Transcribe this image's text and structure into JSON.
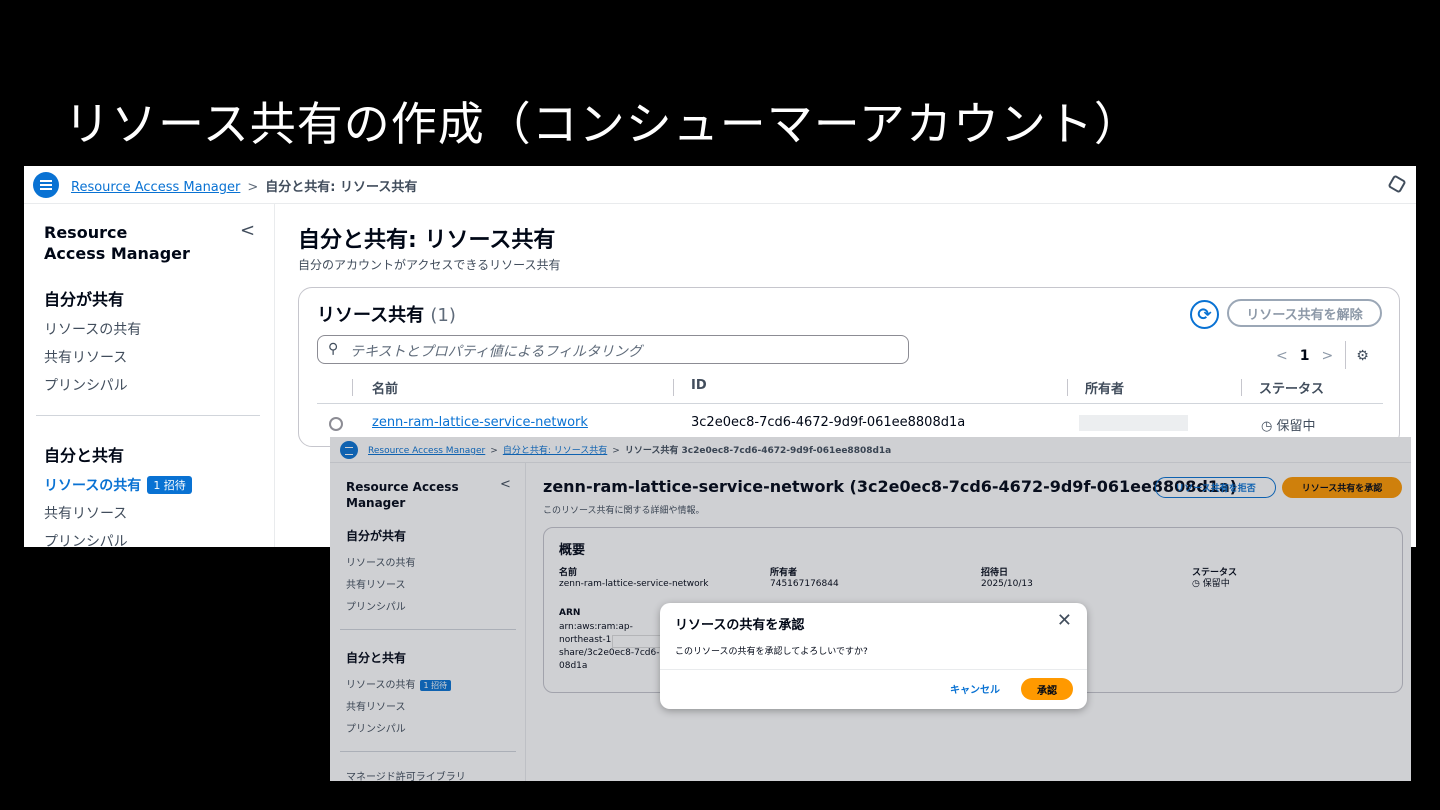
{
  "slide_title": "リソース共有の作成（コンシューマーアカウント）",
  "ss1": {
    "breadcrumb": {
      "root": "Resource Access Manager",
      "sep": ">",
      "current": "自分と共有: リソース共有"
    },
    "sidebar": {
      "title": "Resource Access Manager",
      "collapse": "<",
      "section1": "自分が共有",
      "section1_items": [
        "リソースの共有",
        "共有リソース",
        "プリンシパル"
      ],
      "section2": "自分と共有",
      "section2_items": [
        "リソースの共有",
        "共有リソース",
        "プリンシパル"
      ],
      "badge": "1 招待"
    },
    "page_title": "自分と共有: リソース共有",
    "page_subtitle": "自分のアカウントがアクセスできるリソース共有",
    "card_title": "リソース共有",
    "card_count": "(1)",
    "refresh_icon": "⟳",
    "disassociate_button": "リソース共有を解除",
    "filter_placeholder": "テキストとプロパティ値によるフィルタリング",
    "pager": {
      "prev": "<",
      "page": "1",
      "next": ">"
    },
    "columns": [
      "名前",
      "ID",
      "所有者",
      "ステータス"
    ],
    "row": {
      "name": "zenn-ram-lattice-service-network",
      "id": "3c2e0ec8-7cd6-4672-9d9f-061ee8808d1a",
      "status": "保留中"
    }
  },
  "ss2": {
    "breadcrumb": {
      "root": "Resource Access Manager",
      "mid": "自分と共有: リソース共有",
      "current": "リソース共有 3c2e0ec8-7cd6-4672-9d9f-061ee8808d1a"
    },
    "sidebar": {
      "title": "Resource Access Manager",
      "section1": "自分が共有",
      "section1_items": [
        "リソースの共有",
        "共有リソース",
        "プリンシパル"
      ],
      "section2": "自分と共有",
      "section2_items": [
        "リソースの共有",
        "共有リソース",
        "プリンシパル"
      ],
      "badge": "1 招待",
      "extra": "マネージド許可ライブラリ"
    },
    "page_title": "zenn-ram-lattice-service-network (3c2e0ec8-7cd6-4672-9d9f-061ee8808d1a)",
    "page_subtitle": "このリソース共有に関する詳細や情報。",
    "reject_button": "リソース共有を拒否",
    "accept_button": "リソース共有を承認",
    "overview_title": "概要",
    "fields": {
      "name_label": "名前",
      "name_value": "zenn-ram-lattice-service-network",
      "owner_label": "所有者",
      "owner_value": "745167176844",
      "invited_label": "招待日",
      "invited_value": "2025/10/13",
      "status_label": "ステータス",
      "status_value": "保留中",
      "arn_label": "ARN",
      "arn_lines": [
        "arn:aws:ram:ap-",
        "northeast-1",
        "share/3c2e0ec8-7cd6-",
        "08d1a"
      ]
    },
    "modal": {
      "title": "リソースの共有を承認",
      "close": "✕",
      "body": "このリソースの共有を承認してよろしいですか?",
      "cancel": "キャンセル",
      "confirm": "承認"
    }
  }
}
